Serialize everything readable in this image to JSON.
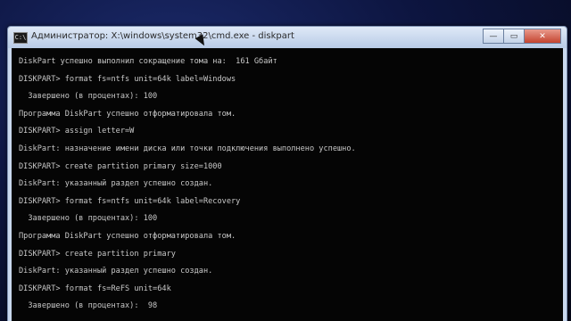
{
  "window": {
    "title": "Администратор: X:\\windows\\system32\\cmd.exe - diskpart",
    "icon_label": "C:\\",
    "controls": {
      "minimize": "—",
      "maximize": "▭",
      "close": "✕"
    }
  },
  "console": {
    "lines": [
      "DiskPart успешно выполнил сокращение тома на:  161 Gбайт",
      "DISKPART> format fs=ntfs unit=64k label=Windows",
      "  Завершено (в процентах): 100",
      "Программа DiskPart успешно отформатировала том.",
      "DISKPART> assign letter=W",
      "DiskPart: назначение имени диска или точки подключения выполнено успешно.",
      "DISKPART> create partition primary size=1000",
      "DiskPart: указанный раздел успешно создан.",
      "DISKPART> format fs=ntfs unit=64k label=Recovery",
      "  Завершено (в процентах): 100",
      "Программа DiskPart успешно отформатировала том.",
      "DISKPART> create partition primary",
      "DiskPart: указанный раздел успешно создан.",
      "DISKPART> format fs=ReFS unit=64k",
      "  Завершено (в процентах):  98"
    ]
  }
}
